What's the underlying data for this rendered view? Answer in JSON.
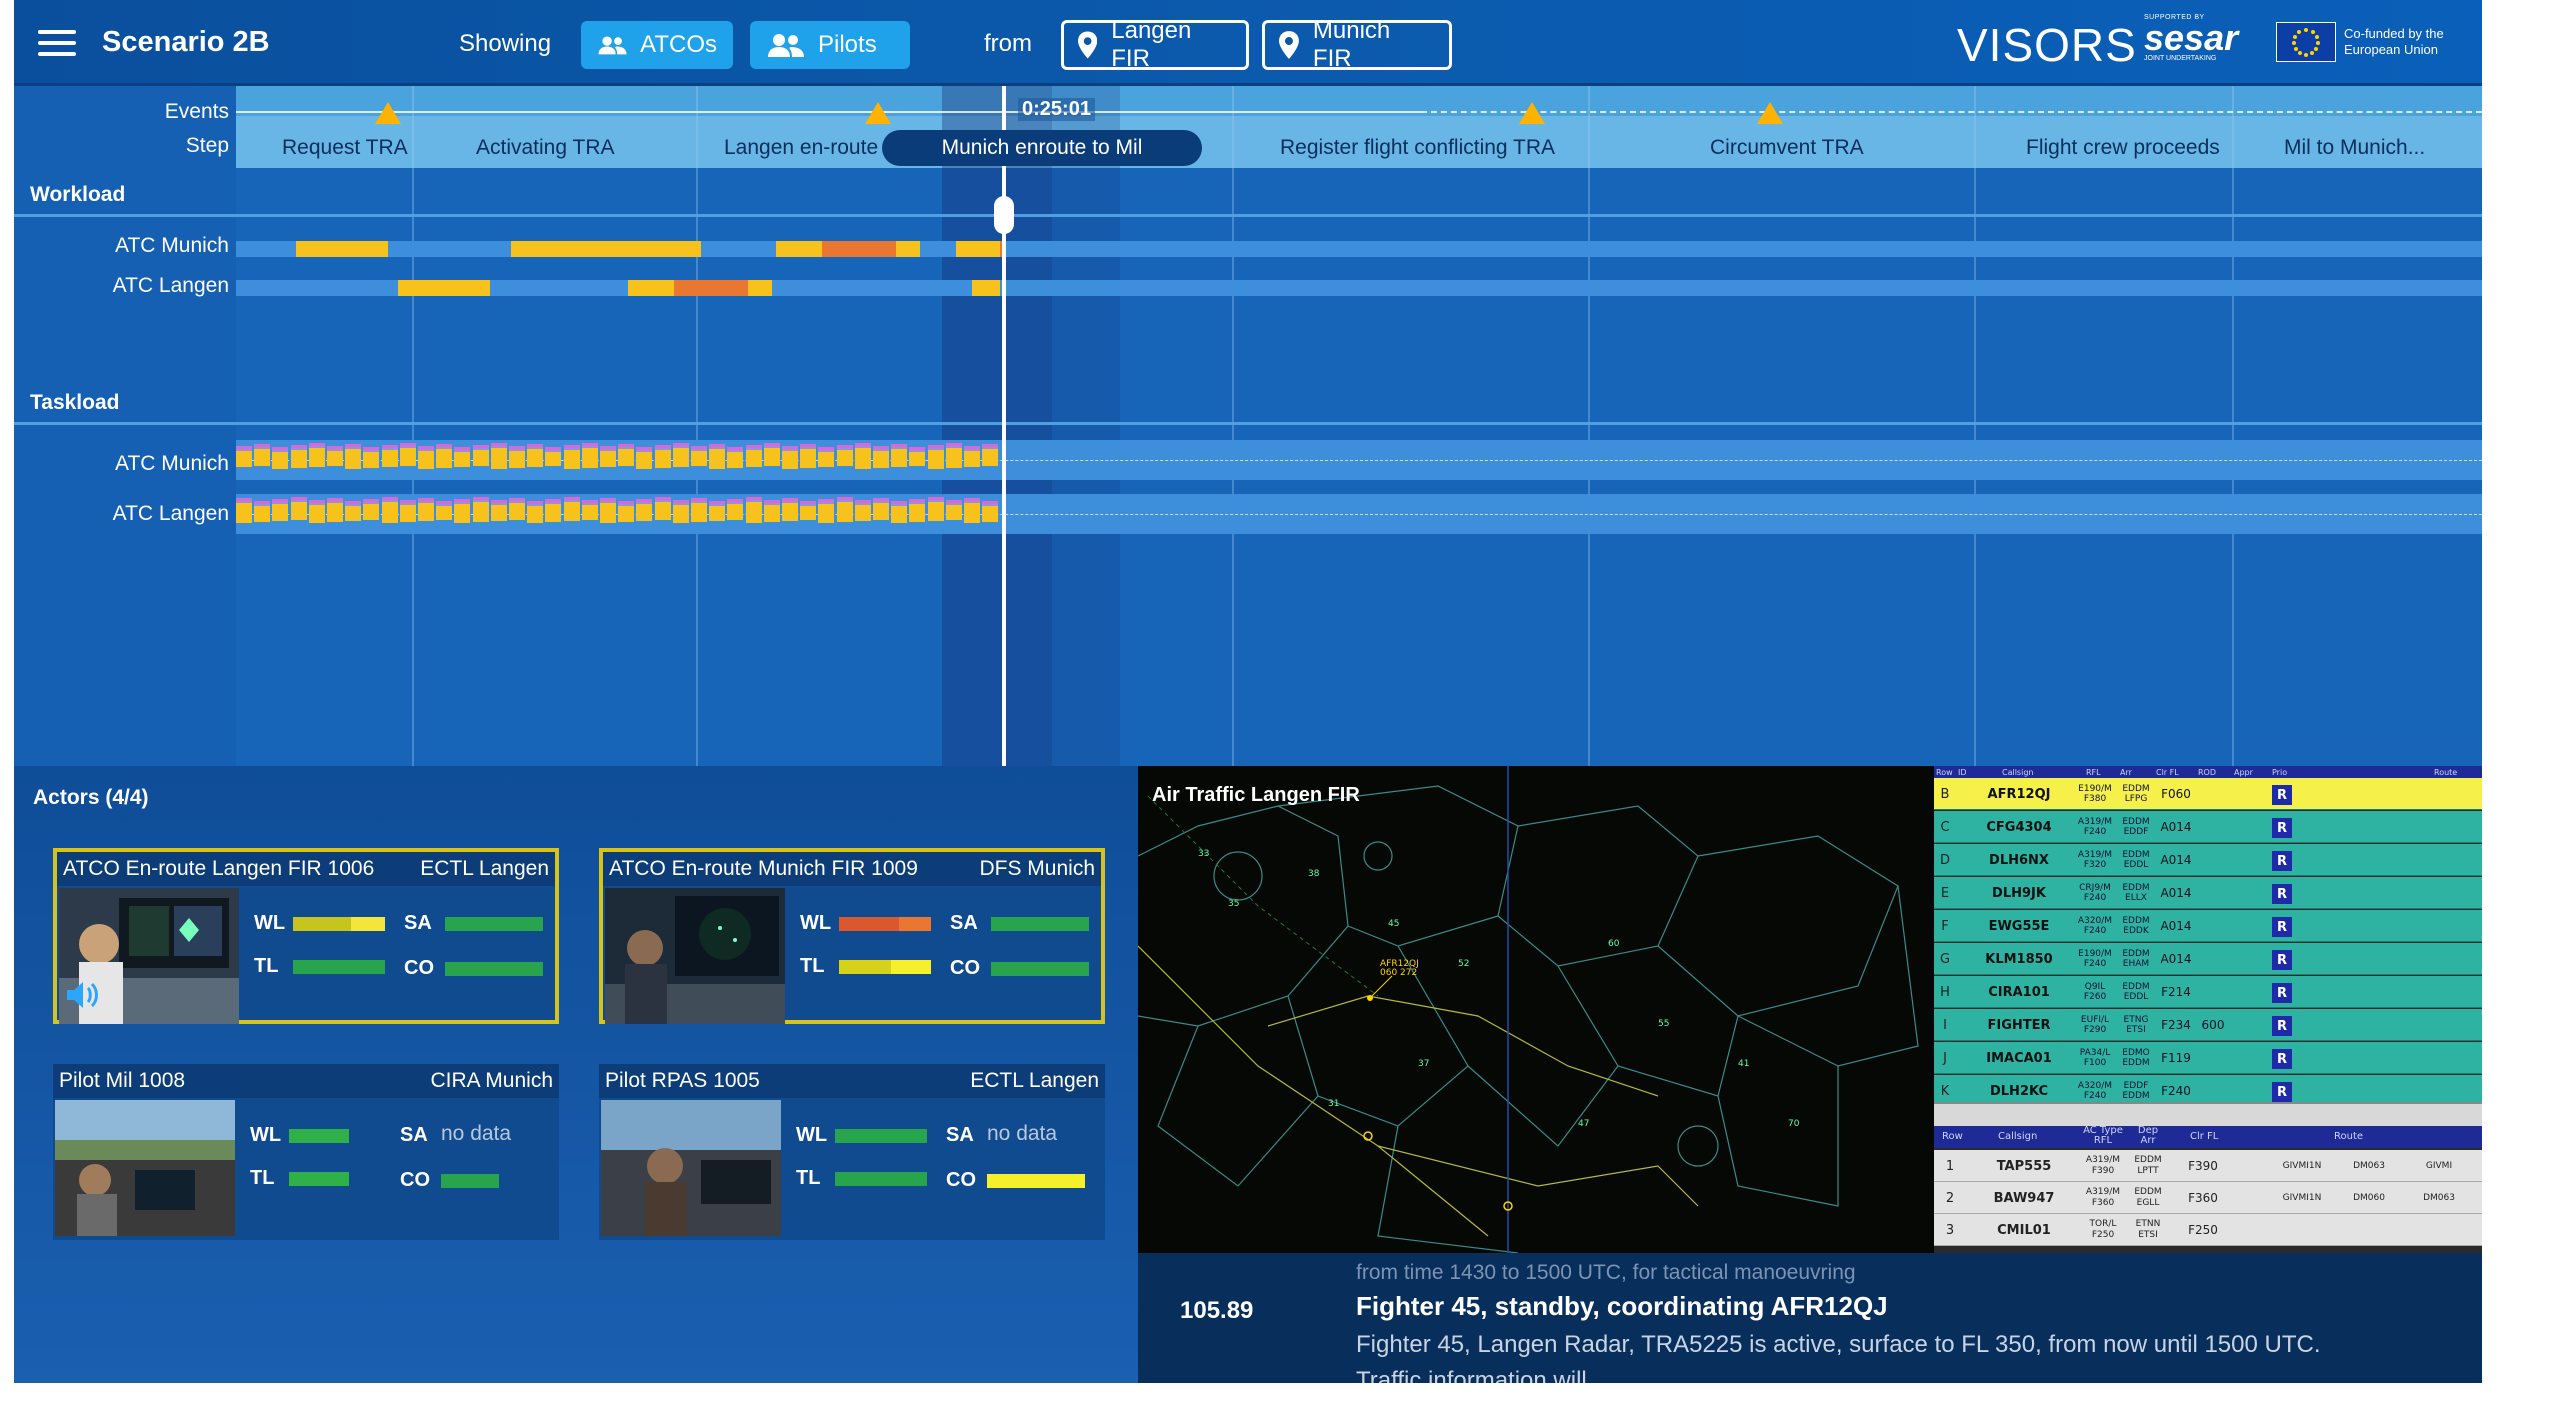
{
  "header": {
    "title": "Scenario 2B",
    "showing_label": "Showing",
    "filters": [
      {
        "label": "ATCOs"
      },
      {
        "label": "Pilots"
      }
    ],
    "from_label": "from",
    "firs": [
      {
        "label": "Langen FIR"
      },
      {
        "label": "Munich FIR"
      }
    ],
    "brand": "VISORS",
    "sesar": {
      "supported": "SUPPORTED BY",
      "name": "sesar",
      "joint": "JOINT UNDERTAKING"
    },
    "eu_text": [
      "Co-funded by the",
      "European Union"
    ]
  },
  "timeline": {
    "events_label": "Events",
    "step_label": "Step",
    "current_time": "0:25:01",
    "current_step": "Munich enroute to Mil",
    "steps": [
      "Request TRA",
      "Activating TRA",
      "Langen en-route t",
      "Register flight conflicting TRA",
      "Circumvent TRA",
      "Flight crew proceeds",
      "Mil to Munich..."
    ],
    "workload_label": "Workload",
    "taskload_label": "Taskload",
    "rows": [
      "ATC Munich",
      "ATC Langen"
    ],
    "colors": {
      "yellow": "#f6c21b",
      "orange": "#e97731",
      "base": "#3d8fdc",
      "pink": "#d86ad8",
      "violet": "#9a8ee0"
    }
  },
  "actors": {
    "title": "Actors (4/4)",
    "cards": [
      {
        "name": "ATCO En-route Langen FIR 1006",
        "org": "ECTL Langen",
        "wl": "WL",
        "tl": "TL",
        "sa": "SA",
        "co": "CO",
        "sa_value": ""
      },
      {
        "name": "ATCO En-route Munich FIR 1009",
        "org": "DFS Munich",
        "wl": "WL",
        "tl": "TL",
        "sa": "SA",
        "co": "CO",
        "sa_value": ""
      },
      {
        "name": "Pilot Mil 1008",
        "org": "CIRA Munich",
        "wl": "WL",
        "tl": "TL",
        "sa": "SA",
        "co": "CO",
        "sa_value": "no data"
      },
      {
        "name": "Pilot RPAS 1005",
        "org": "ECTL Langen",
        "wl": "WL",
        "tl": "TL",
        "sa": "SA",
        "co": "CO",
        "sa_value": "no data"
      }
    ]
  },
  "radar": {
    "title": "Air Traffic Langen FIR",
    "aircraft_label": "AFR12QJ",
    "aircraft_alt": "060 272"
  },
  "strips": {
    "headers": [
      "Row",
      "ID",
      "Callsign",
      "RFL",
      "Arr",
      "Clr FL",
      "ROD",
      "Appr",
      "Prio",
      "Route"
    ],
    "upper": [
      {
        "row": "B",
        "callsign": "AFR12QJ",
        "type": "E190/M",
        "rfl": "F380",
        "dep": "EDDM",
        "arr": "LFPG",
        "clr": "F060",
        "rod": "",
        "hl": true
      },
      {
        "row": "C",
        "callsign": "CFG4304",
        "type": "A319/M",
        "rfl": "F240",
        "dep": "EDDM",
        "arr": "EDDF",
        "clr": "A014",
        "rod": ""
      },
      {
        "row": "D",
        "callsign": "DLH6NX",
        "type": "A319/M",
        "rfl": "F320",
        "dep": "EDDM",
        "arr": "EDDL",
        "clr": "A014",
        "rod": ""
      },
      {
        "row": "E",
        "callsign": "DLH9JK",
        "type": "CRJ9/M",
        "rfl": "F240",
        "dep": "EDDM",
        "arr": "ELLX",
        "clr": "A014",
        "rod": ""
      },
      {
        "row": "F",
        "callsign": "EWG55E",
        "type": "A320/M",
        "rfl": "F240",
        "dep": "EDDM",
        "arr": "EDDK",
        "clr": "A014",
        "rod": ""
      },
      {
        "row": "G",
        "callsign": "KLM1850",
        "type": "E190/M",
        "rfl": "F240",
        "dep": "EDDM",
        "arr": "EHAM",
        "clr": "A014",
        "rod": ""
      },
      {
        "row": "H",
        "callsign": "CIRA101",
        "type": "Q9IL",
        "rfl": "F260",
        "dep": "EDDM",
        "arr": "EDDL",
        "clr": "F214",
        "rod": ""
      },
      {
        "row": "I",
        "callsign": "FIGHTER",
        "type": "EUFI/L",
        "rfl": "F290",
        "dep": "ETNG",
        "arr": "ETSI",
        "clr": "F234",
        "rod": "600"
      },
      {
        "row": "J",
        "callsign": "IMACA01",
        "type": "PA34/L",
        "rfl": "F100",
        "dep": "EDMO",
        "arr": "EDDM",
        "clr": "F119",
        "rod": ""
      },
      {
        "row": "K",
        "callsign": "DLH2KC",
        "type": "A320/M",
        "rfl": "F240",
        "dep": "EDDF",
        "arr": "EDDM",
        "clr": "F240",
        "rod": ""
      }
    ],
    "lower_headers": [
      "Row",
      "Callsign",
      "AC Type RFL",
      "Dep Arr",
      "Clr FL",
      "Route"
    ],
    "lower": [
      {
        "row": "1",
        "callsign": "TAP555",
        "type": "A319/M",
        "rfl": "F390",
        "dep": "EDDM",
        "arr": "LPTT",
        "clr": "F390",
        "r1": "GIVMI1N",
        "r2": "DM063",
        "r3": "GIVMI"
      },
      {
        "row": "2",
        "callsign": "BAW947",
        "type": "A319/M",
        "rfl": "F360",
        "dep": "EDDM",
        "arr": "EGLL",
        "clr": "F360",
        "r1": "GIVMI1N",
        "r2": "DM060",
        "r3": "DM063"
      },
      {
        "row": "3",
        "callsign": "CMIL01",
        "type": "TOR/L",
        "rfl": "F250",
        "dep": "ETNN",
        "arr": "ETSI",
        "clr": "F250",
        "r1": "",
        "r2": "",
        "r3": ""
      }
    ]
  },
  "transcript": {
    "frequency": "105.89",
    "previous": "from time 1430 to 1500 UTC, for tactical manoeuvring",
    "current": "Fighter 45, standby, coordinating AFR12QJ",
    "next": "Fighter 45, Langen Radar, TRA5225 is active, surface to FL 350, from now until 1500 UTC.",
    "next2": "Traffic information will..."
  }
}
